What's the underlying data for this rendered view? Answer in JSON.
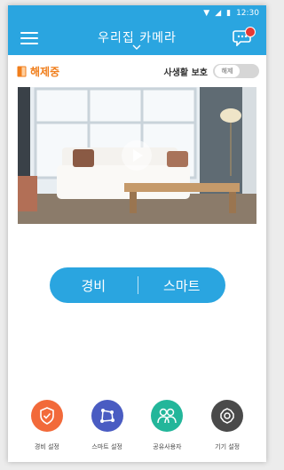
{
  "status_bar": {
    "time": "12:30"
  },
  "header": {
    "title": "우리집 카메라"
  },
  "security_status": {
    "label": "해제중",
    "color": "#f07e1b"
  },
  "privacy": {
    "label": "사생활 보호",
    "toggle_text": "해제"
  },
  "mode_switch": {
    "left": "경비",
    "right": "스마트"
  },
  "bottom_menu": [
    {
      "label": "경비 설정",
      "color": "#f26a3a"
    },
    {
      "label": "스마트 설정",
      "color": "#4a5cc2"
    },
    {
      "label": "공유사용자",
      "color": "#23b69a"
    },
    {
      "label": "기기 설정",
      "color": "#4a4a4a"
    }
  ],
  "colors": {
    "primary": "#2aa5e0"
  }
}
